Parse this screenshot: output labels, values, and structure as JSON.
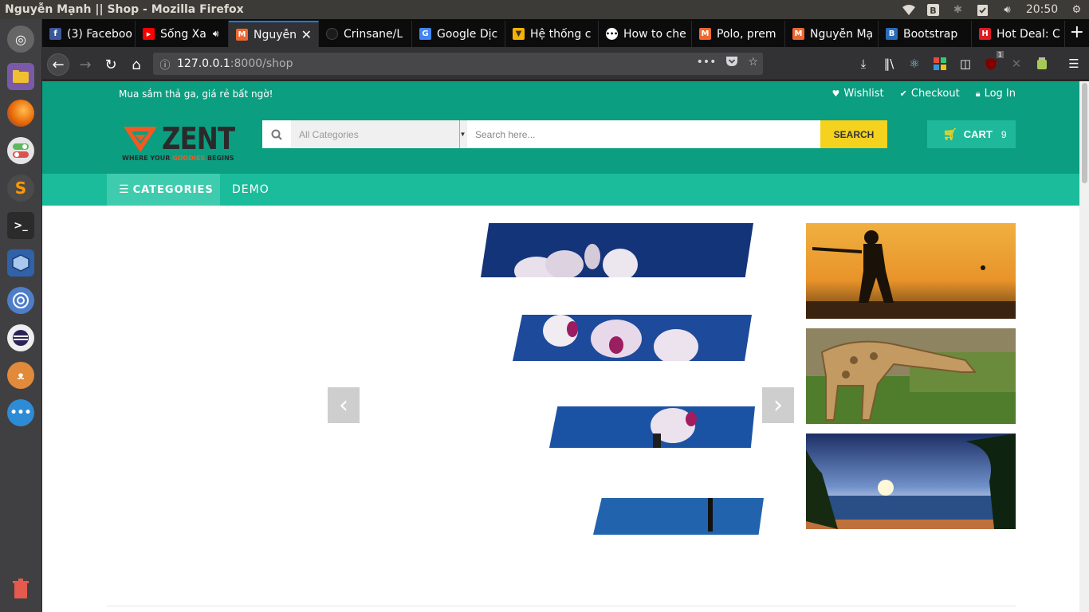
{
  "window": {
    "title": "Nguyễn Mạnh || Shop - Mozilla Firefox"
  },
  "system": {
    "clock": "20:50",
    "badge_count": "1"
  },
  "tabs": [
    {
      "label": "(3) Faceboo",
      "fav": "f",
      "color": "#3b5998"
    },
    {
      "label": "Sống Xa",
      "fav": "▶",
      "color": "#ff0000"
    },
    {
      "label": "Nguyễn",
      "fav": "⬢",
      "color": "#ee672f"
    },
    {
      "label": "Crinsane/L",
      "fav": "●",
      "color": "#1b1b1b"
    },
    {
      "label": "Google Dịc",
      "fav": "G",
      "color": "#4285f4"
    },
    {
      "label": "Hệ thống c",
      "fav": "▼",
      "color": "#f5b301"
    },
    {
      "label": "How to che",
      "fav": "●",
      "color": "#ffffff"
    },
    {
      "label": "Polo, prem",
      "fav": "⬢",
      "color": "#ee672f"
    },
    {
      "label": "Nguyễn Mạ",
      "fav": "⬢",
      "color": "#ee672f"
    },
    {
      "label": "Bootstrap",
      "fav": "B",
      "color": "#2a6db7"
    },
    {
      "label": "Hot Deal: C",
      "fav": "H",
      "color": "#e01b22"
    }
  ],
  "url": {
    "host": "127.0.0.1",
    "path": ":8000/shop"
  },
  "site": {
    "promo": "Mua sắm thả ga, giá rẻ bất ngờ!",
    "links": {
      "wishlist": "Wishlist",
      "checkout": "Checkout",
      "login": "Log In"
    },
    "logo": {
      "word": "ZENT",
      "tag_before": "WHERE YOUR ",
      "tag_highlight": "GOODIES",
      "tag_after": " BEGINS"
    },
    "search": {
      "category": "All Categories",
      "placeholder": "Search here...",
      "button": "SEARCH"
    },
    "cart": {
      "label": "CART",
      "count": "9"
    },
    "menu": {
      "categories": "CATEGORIES",
      "demo": "DEMO"
    },
    "slider": {
      "prev": "‹",
      "next": "›"
    }
  },
  "colors": {
    "primary": "#0b9e80",
    "menu": "#1bbc9b",
    "accent": "#f5d21d"
  }
}
